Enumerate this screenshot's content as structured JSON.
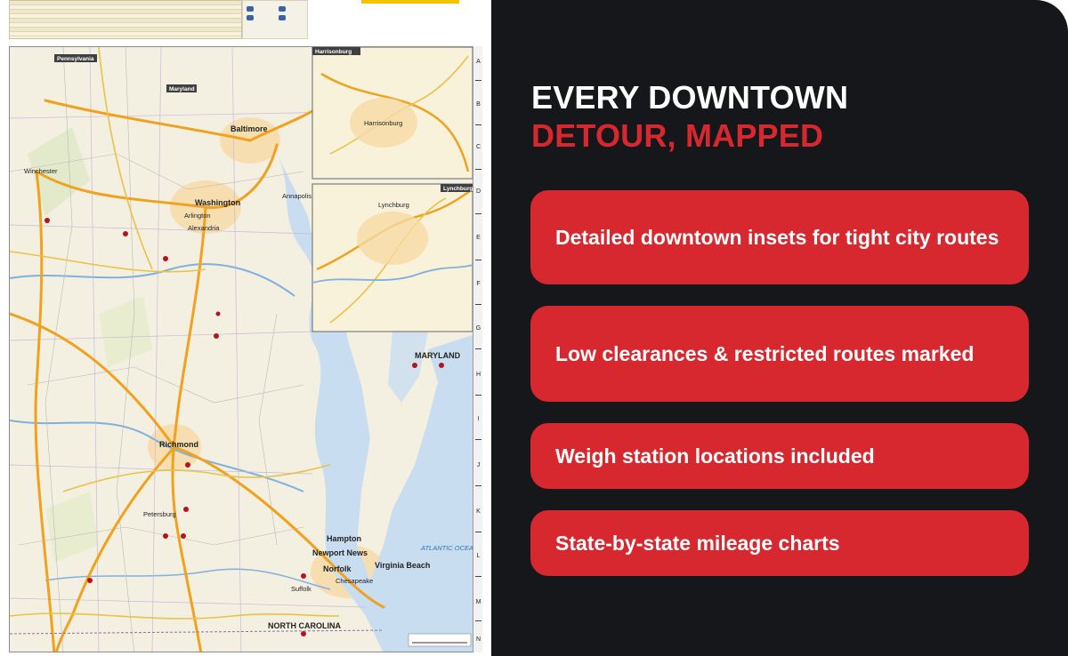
{
  "headline": {
    "line1": "EVERY DOWNTOWN",
    "line2": "DETOUR, MAPPED"
  },
  "features": [
    {
      "label": "Detailed downtown insets for tight city routes"
    },
    {
      "label": "Low clearances & restricted routes marked"
    },
    {
      "label": "Weigh station locations included"
    },
    {
      "label": "State-by-state mileage charts"
    }
  ],
  "map": {
    "cities": [
      "Baltimore",
      "Washington",
      "Arlington",
      "Alexandria",
      "Annapolis",
      "Richmond",
      "Petersburg",
      "Hampton",
      "Newport News",
      "Norfolk",
      "Chesapeake",
      "Virginia Beach",
      "Suffolk",
      "Winchester"
    ],
    "insets": [
      "Harrisonburg",
      "Lynchburg"
    ],
    "regions": [
      "Pennsylvania",
      "Maryland",
      "MARYLAND",
      "NORTH CAROLINA"
    ],
    "water": [
      "ATLANTIC OCEAN"
    ],
    "index_letters": [
      "A",
      "B",
      "C",
      "D",
      "E",
      "F",
      "G",
      "H",
      "I",
      "J",
      "K",
      "L",
      "M",
      "N"
    ]
  },
  "colors": {
    "panel_bg": "#16171a",
    "accent_red": "#d8282f",
    "headline_white": "#ffffff",
    "map_land": "#f3efe1",
    "map_water": "#c8ddf0",
    "map_highway": "#f0a21e"
  }
}
